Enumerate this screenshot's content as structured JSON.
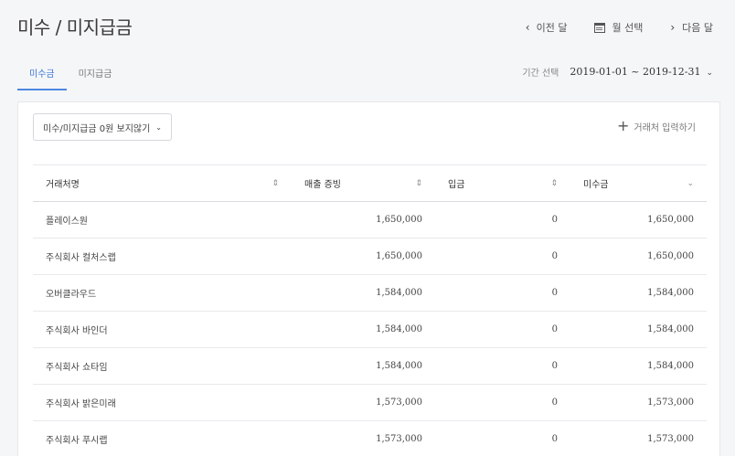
{
  "header": {
    "title": "미수 / 미지급금",
    "prev_label": "이전 달",
    "month_select_label": "월 선택",
    "next_label": "다음 달"
  },
  "tabs": [
    {
      "label": "미수금",
      "active": true
    },
    {
      "label": "미지급금",
      "active": false
    }
  ],
  "period": {
    "label": "기간 선택",
    "value": "2019-01-01 ~ 2019-12-31"
  },
  "filter": {
    "label": "미수/미지급금 0원 보지않기"
  },
  "add_client_label": "거래처 입력하기",
  "table": {
    "columns": [
      "거래처명",
      "매출 증빙",
      "입금",
      "미수금"
    ],
    "rows": [
      [
        "플레이스원",
        "1,650,000",
        "0",
        "1,650,000"
      ],
      [
        "주식회사 컬처스랩",
        "1,650,000",
        "0",
        "1,650,000"
      ],
      [
        "오버클라우드",
        "1,584,000",
        "0",
        "1,584,000"
      ],
      [
        "주식회사 바인더",
        "1,584,000",
        "0",
        "1,584,000"
      ],
      [
        "주식회사 쇼타임",
        "1,584,000",
        "0",
        "1,584,000"
      ],
      [
        "주식회사 밝은미래",
        "1,573,000",
        "0",
        "1,573,000"
      ],
      [
        "주식회사 푸시랩",
        "1,573,000",
        "0",
        "1,573,000"
      ]
    ]
  },
  "colors": {
    "accent": "#3b74d9"
  }
}
